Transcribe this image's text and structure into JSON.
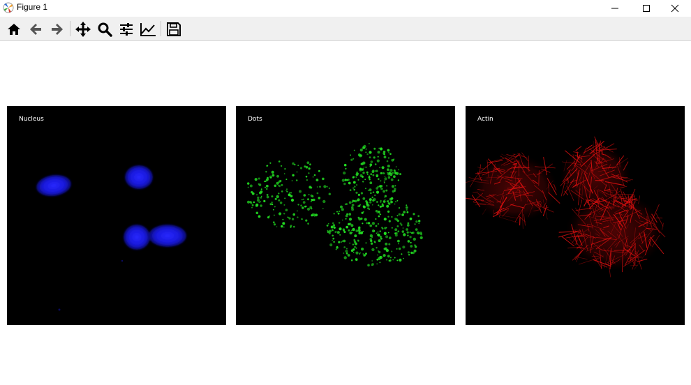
{
  "window": {
    "title": "Figure 1",
    "icon": "matplotlib-icon",
    "controls": [
      "minimize-icon",
      "maximize-icon",
      "close-icon"
    ]
  },
  "toolbar": {
    "buttons": [
      "home-icon",
      "back-arrow-icon",
      "forward-arrow-icon",
      "pan-icon",
      "zoom-icon",
      "configure-subplots-icon",
      "edit-axis-icon",
      "save-icon"
    ]
  },
  "panels": [
    {
      "label": "Nucleus",
      "color": "#1a1aff"
    },
    {
      "label": "Dots",
      "color": "#22dd22"
    },
    {
      "label": "Actin",
      "color": "#e01010"
    }
  ],
  "colors": {
    "titlebar": "#ffffff",
    "toolbar": "#f0f0f0",
    "panel_background": "#000000"
  }
}
